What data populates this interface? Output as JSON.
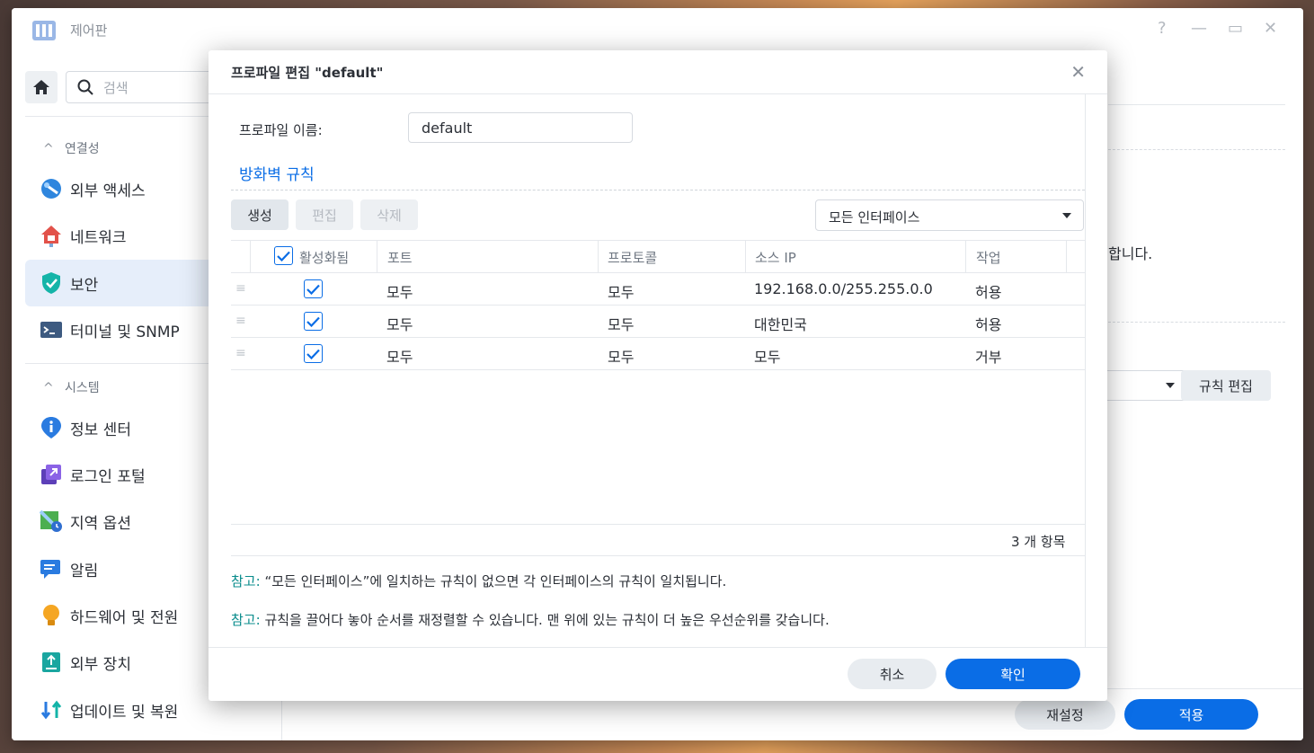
{
  "window": {
    "title": "제어판",
    "controls": [
      "?",
      "—",
      "▭",
      "✕"
    ]
  },
  "sidebar": {
    "search_placeholder": "검색",
    "sections": [
      {
        "label": "연결성"
      },
      {
        "label": "시스템"
      }
    ],
    "items": [
      {
        "label": "외부 액세스",
        "icon": "external-access-icon"
      },
      {
        "label": "네트워크",
        "icon": "network-house-icon"
      },
      {
        "label": "보안",
        "icon": "shield-check-icon",
        "active": true
      },
      {
        "label": "터미널 및 SNMP",
        "icon": "terminal-icon"
      },
      {
        "label": "정보 센터",
        "icon": "info-icon"
      },
      {
        "label": "로그인 포털",
        "icon": "login-portal-icon"
      },
      {
        "label": "지역 옵션",
        "icon": "map-clock-icon"
      },
      {
        "label": "알림",
        "icon": "notification-icon"
      },
      {
        "label": "하드웨어 및 전원",
        "icon": "lightbulb-icon"
      },
      {
        "label": "외부 장치",
        "icon": "usb-device-icon"
      },
      {
        "label": "업데이트 및 복원",
        "icon": "update-arrows-icon"
      }
    ]
  },
  "background_panel": {
    "partial_text": "합니다.",
    "edit_rules_button": "규칙 편집",
    "reset_button": "재설정",
    "apply_button": "적용"
  },
  "dialog": {
    "title": "프로파일 편집 \"default\"",
    "profile_name_label": "프로파일 이름:",
    "profile_name_value": "default",
    "group_title": "방화벽 규칙",
    "toolbar": {
      "create": "생성",
      "edit": "편집",
      "delete": "삭제"
    },
    "interface_select": "모든 인터페이스",
    "columns": [
      "활성화됨",
      "포트",
      "프로토콜",
      "소스 IP",
      "작업"
    ],
    "rows": [
      {
        "enabled": true,
        "port": "모두",
        "protocol": "모두",
        "source_ip": "192.168.0.0/255.255.0.0",
        "action": "허용"
      },
      {
        "enabled": true,
        "port": "모두",
        "protocol": "모두",
        "source_ip": "대한민국",
        "action": "허용"
      },
      {
        "enabled": true,
        "port": "모두",
        "protocol": "모두",
        "source_ip": "모두",
        "action": "거부"
      }
    ],
    "item_count": "3 개 항목",
    "notes": [
      {
        "label": "참고:",
        "text": "“모든 인터페이스”에 일치하는 규칙이 없으면 각 인터페이스의 규칙이 일치됩니다."
      },
      {
        "label": "참고:",
        "text": "규칙을 끌어다 놓아 순서를 재정렬할 수 있습니다. 맨 위에 있는 규칙이 더 높은 우선순위를 갖습니다."
      }
    ],
    "cancel_button": "취소",
    "ok_button": "확인"
  },
  "colors": {
    "accent": "#0a6de6",
    "note_label": "#0a8c8c",
    "active_nav_bg": "#e6eefa"
  }
}
